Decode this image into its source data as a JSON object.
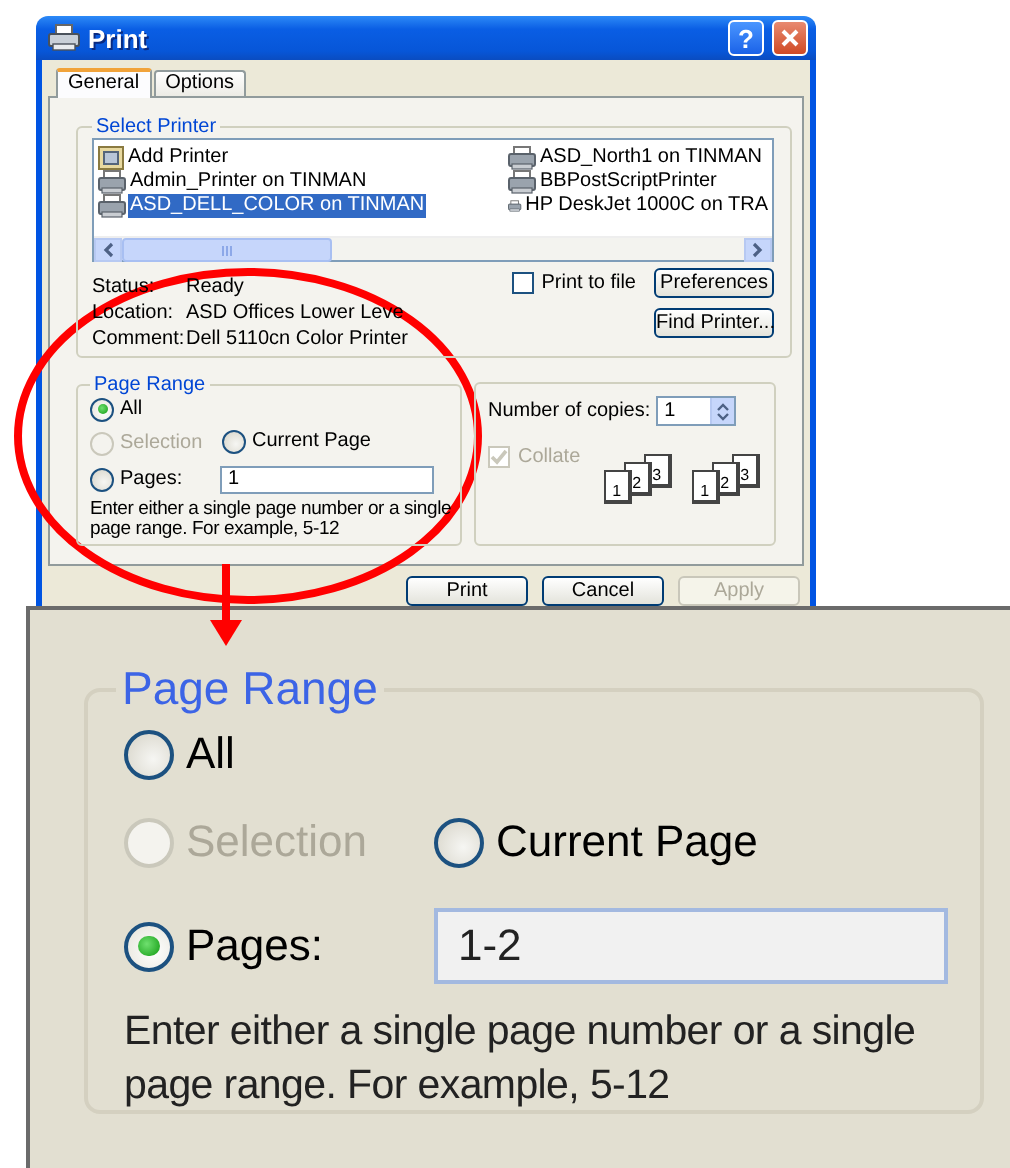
{
  "window": {
    "title": "Print",
    "help_button": "?"
  },
  "tabs": [
    {
      "label": "General",
      "selected": true
    },
    {
      "label": "Options",
      "selected": false
    }
  ],
  "select_printer": {
    "title": "Select Printer",
    "printers": [
      {
        "name": "Add Printer",
        "kind": "add",
        "selected": false
      },
      {
        "name": "Admin_Printer on TINMAN",
        "kind": "printer",
        "selected": false
      },
      {
        "name": "ASD_DELL_COLOR on TINMAN",
        "kind": "printer",
        "selected": true
      },
      {
        "name": "ASD_North1 on TINMAN",
        "kind": "printer",
        "selected": false
      },
      {
        "name": "BBPostScriptPrinter",
        "kind": "printer",
        "selected": false
      },
      {
        "name": "HP DeskJet 1000C on TRA",
        "kind": "printer",
        "selected": false
      }
    ],
    "status": [
      {
        "label": "Status:",
        "value": "Ready"
      },
      {
        "label": "Location:",
        "value": "ASD Offices Lower Leve"
      },
      {
        "label": "Comment:",
        "value": "Dell 5110cn Color Printer"
      }
    ],
    "print_to_file": {
      "label": "Print to file",
      "checked": false
    },
    "buttons": [
      "Preferences",
      "Find Printer..."
    ]
  },
  "page_range": {
    "title": "Page Range",
    "options": [
      {
        "label": "All",
        "selected": true,
        "disabled": false
      },
      {
        "label": "Selection",
        "selected": false,
        "disabled": true
      },
      {
        "label": "Current Page",
        "selected": false,
        "disabled": false
      },
      {
        "label": "Pages:",
        "selected": false,
        "disabled": false
      }
    ],
    "pages_value": "1",
    "hint": "Enter either a single page number or a single page range.  For example, 5-12"
  },
  "copies": {
    "label": "Number of copies:",
    "value": "1",
    "collate": {
      "label": "Collate",
      "checked": true,
      "disabled": true
    },
    "stacks": [
      [
        "1",
        "2",
        "3"
      ],
      [
        "1",
        "2",
        "3"
      ]
    ]
  },
  "buttons": [
    {
      "label": "Print",
      "disabled": false
    },
    {
      "label": "Cancel",
      "disabled": false
    },
    {
      "label": "Apply",
      "disabled": true
    }
  ],
  "zoom_inset": {
    "page_range": {
      "title": "Page Range",
      "options": [
        {
          "label": "All",
          "selected": false,
          "disabled": false
        },
        {
          "label": "Selection",
          "selected": false,
          "disabled": true
        },
        {
          "label": "Current Page",
          "selected": false,
          "disabled": false
        },
        {
          "label": "Pages:",
          "selected": true,
          "disabled": false
        }
      ],
      "pages_value": "1-2",
      "hint": "Enter either a single page number or a single page range.  For example, 5-12"
    }
  }
}
